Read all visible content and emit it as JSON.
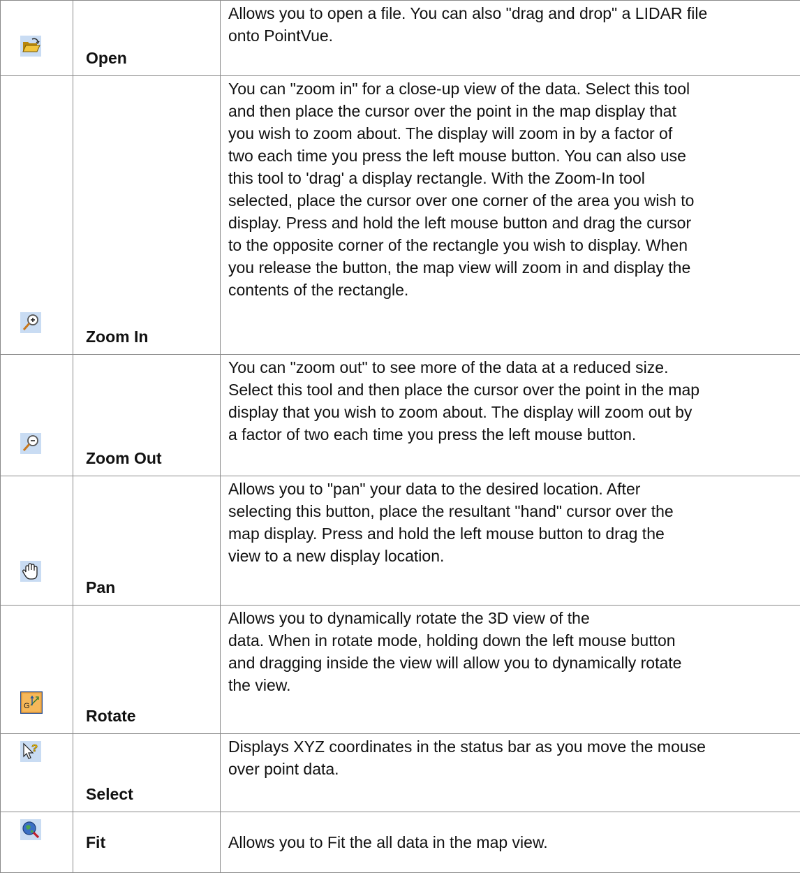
{
  "tools": [
    {
      "icon": "open-folder-icon",
      "name": "Open",
      "description": "Allows you to open a file. You can also \"drag and drop\" a LIDAR file\nonto PointVue."
    },
    {
      "icon": "zoom-in-icon",
      "name": "Zoom In",
      "description": "You can \"zoom in\" for a close-up view of the data. Select this tool\nand then place the cursor over the point in the map display that\nyou wish to zoom about.  The display will zoom in by a factor of\ntwo each time you press the left mouse button. You can also use\nthis tool to 'drag' a display rectangle.  With the Zoom-In tool\nselected, place the cursor over one corner of the area you wish to\ndisplay.  Press and hold the left mouse button and drag the cursor\nto the opposite corner of the rectangle you wish to display.  When\nyou release the button, the map view will zoom in and display the\ncontents of the rectangle."
    },
    {
      "icon": "zoom-out-icon",
      "name": "Zoom Out",
      "description": "You can \"zoom out\" to see more of the data at a reduced size.\nSelect this tool and then place the cursor over the point in the map\ndisplay that you wish to zoom about.  The display will zoom out by\na factor of two each time you press the left mouse button."
    },
    {
      "icon": "hand-pan-icon",
      "name": "Pan",
      "description": "Allows you to \"pan\" your data to the desired location. After\nselecting this button, place the resultant \"hand\" cursor over the\nmap display.  Press and hold the left mouse button to drag the\nview to a new display location."
    },
    {
      "icon": "rotate-3d-icon",
      "name": "Rotate",
      "description": "Allows you to dynamically rotate the 3D view of the\ndata.  When  in rotate mode, holding down the left mouse button\nand dragging inside the view will allow you to dynamically rotate\nthe view."
    },
    {
      "icon": "select-query-icon",
      "name": "Select",
      "description": "Displays XYZ coordinates in the status bar as you move the mouse\nover point data."
    },
    {
      "icon": "fit-globe-icon",
      "name": "Fit",
      "description": "Allows you to Fit the all data in the map view."
    }
  ]
}
